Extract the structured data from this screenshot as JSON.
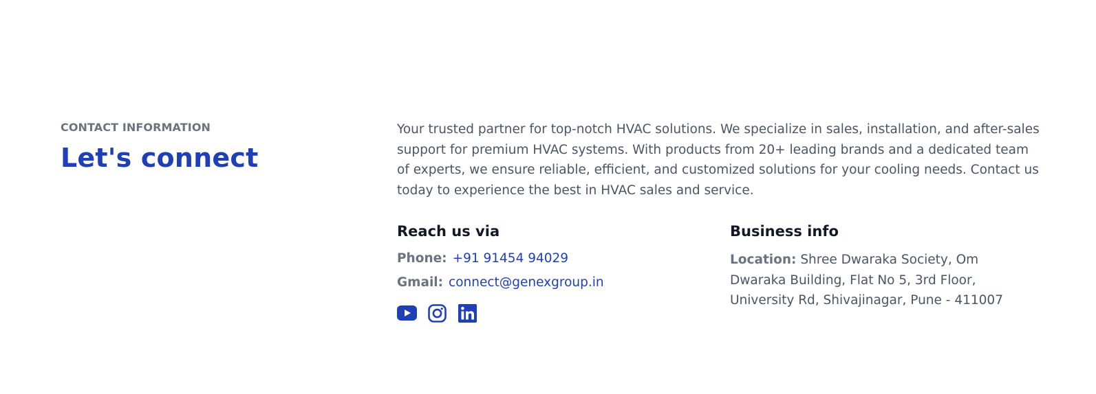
{
  "header": {
    "eyebrow": "CONTACT INFORMATION",
    "title": "Let's connect"
  },
  "about": {
    "text": "Your trusted partner for top-notch HVAC solutions. We specialize in sales, installation, and after-sales support for premium HVAC systems. With products from 20+ leading brands and a dedicated team of experts, we ensure reliable, efficient, and customized solutions for your cooling needs. Contact us today to experience the best in HVAC sales and service."
  },
  "reach": {
    "title": "Reach us via",
    "phone_label": "Phone:",
    "phone_value": "+91 91454 94029",
    "gmail_label": "Gmail:",
    "gmail_value": "connect@genexgroup.in",
    "socials": [
      {
        "name": "youtube",
        "icon": "youtube-icon"
      },
      {
        "name": "instagram",
        "icon": "instagram-icon"
      },
      {
        "name": "linkedin",
        "icon": "linkedin-icon"
      }
    ]
  },
  "business": {
    "title": "Business info",
    "location_label": "Location:",
    "location_value": "Shree Dwaraka Society, Om Dwaraka Building, Flat No 5, 3rd Floor, University Rd, Shivajinagar, Pune - 411007"
  },
  "colors": {
    "accent": "#1e3fb5",
    "muted": "#6b7280",
    "body_text": "#4b5563",
    "heading": "#111827"
  }
}
